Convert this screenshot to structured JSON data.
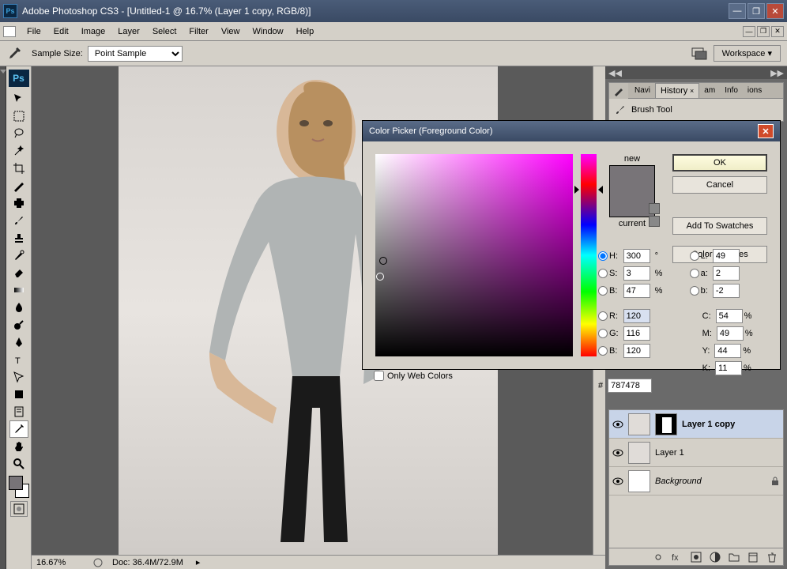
{
  "titlebar": {
    "icon_text": "Ps",
    "title": "Adobe Photoshop CS3 - [Untitled-1 @ 16.7% (Layer 1 copy, RGB/8)]"
  },
  "menubar": {
    "items": [
      "File",
      "Edit",
      "Image",
      "Layer",
      "Select",
      "Filter",
      "View",
      "Window",
      "Help"
    ]
  },
  "optionsbar": {
    "sample_size_label": "Sample Size:",
    "sample_size_value": "Point Sample",
    "workspace_label": "Workspace ▾"
  },
  "toolbar": {
    "ps_logo": "Ps",
    "fg_color": "#787478",
    "bg_color": "#ffffff"
  },
  "statusbar": {
    "zoom": "16.67%",
    "doc_info": "Doc: 36.4M/72.9M"
  },
  "color_picker": {
    "title": "Color Picker (Foreground Color)",
    "new_label": "new",
    "current_label": "current",
    "buttons": {
      "ok": "OK",
      "cancel": "Cancel",
      "add_swatch": "Add To Swatches",
      "color_libs": "Color Libraries"
    },
    "web_colors_label": "Only Web Colors",
    "values": {
      "H": "300",
      "H_unit": "°",
      "S": "3",
      "S_unit": "%",
      "B": "47",
      "B_unit": "%",
      "R": "120",
      "G": "116",
      "Bv": "120",
      "L": "49",
      "a": "2",
      "bv": "-2",
      "C": "54",
      "C_unit": "%",
      "M": "49",
      "M_unit": "%",
      "Y": "44",
      "Y_unit": "%",
      "K": "11",
      "K_unit": "%",
      "hex_prefix": "#",
      "hex": "787478"
    },
    "labels": {
      "H": "H:",
      "S": "S:",
      "B": "B:",
      "R": "R:",
      "G": "G:",
      "Bv": "B:",
      "L": "L:",
      "a": "a:",
      "bv": "b:",
      "C": "C:",
      "M": "M:",
      "Y": "Y:",
      "K": "K:"
    }
  },
  "panels": {
    "tabs1": [
      "Navi",
      "History",
      "am",
      "Info",
      "ions"
    ],
    "history_item": "Brush Tool",
    "layers": [
      {
        "name": "Layer 1 copy",
        "has_mask": true,
        "selected": true,
        "italic": false,
        "locked": false
      },
      {
        "name": "Layer 1",
        "has_mask": false,
        "selected": false,
        "italic": false,
        "locked": false
      },
      {
        "name": "Background",
        "has_mask": false,
        "selected": false,
        "italic": true,
        "locked": true
      }
    ]
  }
}
